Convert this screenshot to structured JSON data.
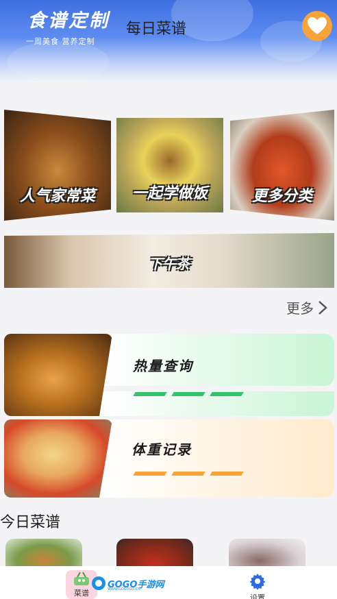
{
  "header": {
    "brand_title": "食谱定制",
    "brand_subtitle": "一周美食 营养定制",
    "page_title": "每日菜谱",
    "favorite_icon": "heart-icon"
  },
  "categories": [
    {
      "label": "人气家常菜"
    },
    {
      "label": "一起学做饭"
    },
    {
      "label": "更多分类"
    }
  ],
  "banner": {
    "label": "下午茶"
  },
  "more": {
    "label": "更多",
    "icon": "chevron-right-icon"
  },
  "features": [
    {
      "label": "热量查询",
      "accent": "#34c26a"
    },
    {
      "label": "体重记录",
      "accent": "#f7a33a"
    }
  ],
  "today": {
    "title": "今日菜谱"
  },
  "tabbar": {
    "recipe_label": "菜谱",
    "settings_label": "设置",
    "watermark_text": "GOGO手游网",
    "watermark_sub": "WWW.GOGOGO.CN"
  },
  "colors": {
    "header_blue": "#3e6fe0",
    "heart_orange": "#f7a33a",
    "settings_blue": "#2b6be6",
    "recipe_tab_pink": "#fbd5df"
  }
}
